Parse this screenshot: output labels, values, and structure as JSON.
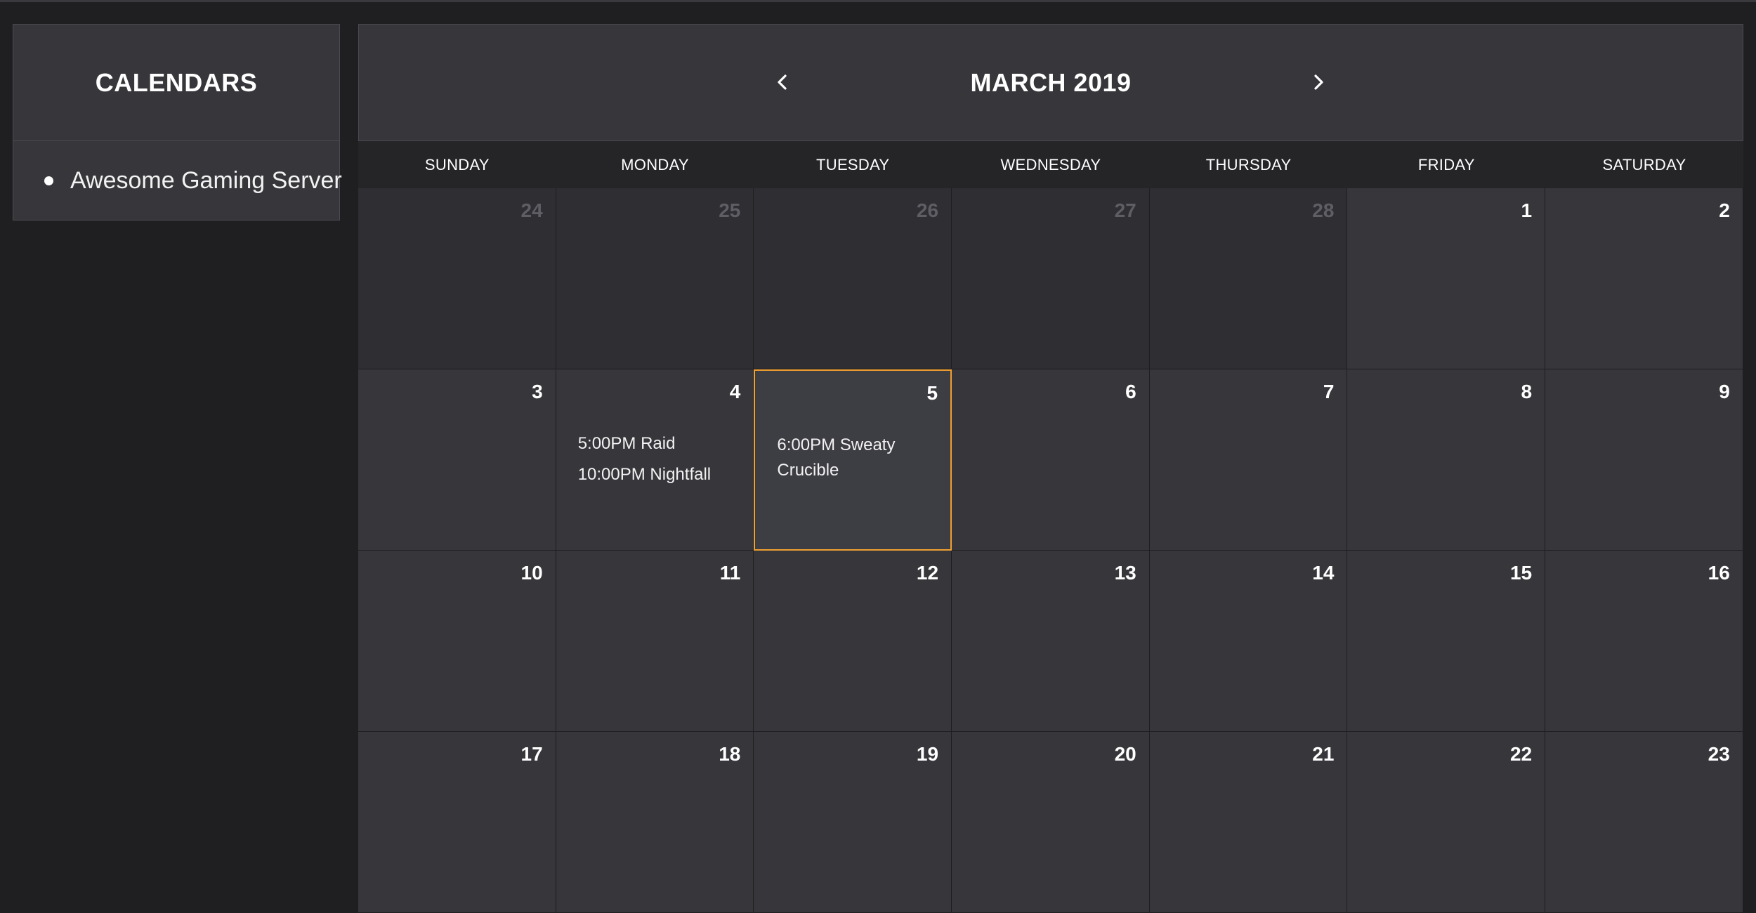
{
  "sidebar": {
    "title": "CALENDARS",
    "items": [
      {
        "label": "Awesome Gaming Server"
      }
    ]
  },
  "calendar": {
    "month_title": "MARCH 2019",
    "weekdays": [
      "SUNDAY",
      "MONDAY",
      "TUESDAY",
      "WEDNESDAY",
      "THURSDAY",
      "FRIDAY",
      "SATURDAY"
    ],
    "weeks": [
      [
        {
          "day": "24",
          "other": true,
          "events": []
        },
        {
          "day": "25",
          "other": true,
          "events": []
        },
        {
          "day": "26",
          "other": true,
          "events": []
        },
        {
          "day": "27",
          "other": true,
          "events": []
        },
        {
          "day": "28",
          "other": true,
          "events": []
        },
        {
          "day": "1",
          "other": false,
          "events": []
        },
        {
          "day": "2",
          "other": false,
          "events": []
        }
      ],
      [
        {
          "day": "3",
          "other": false,
          "events": []
        },
        {
          "day": "4",
          "other": false,
          "events": [
            "5:00PM Raid",
            "10:00PM Nightfall"
          ]
        },
        {
          "day": "5",
          "other": false,
          "selected": true,
          "events": [
            "6:00PM Sweaty Crucible"
          ]
        },
        {
          "day": "6",
          "other": false,
          "events": []
        },
        {
          "day": "7",
          "other": false,
          "events": []
        },
        {
          "day": "8",
          "other": false,
          "events": []
        },
        {
          "day": "9",
          "other": false,
          "events": []
        }
      ],
      [
        {
          "day": "10",
          "other": false,
          "events": []
        },
        {
          "day": "11",
          "other": false,
          "events": []
        },
        {
          "day": "12",
          "other": false,
          "events": []
        },
        {
          "day": "13",
          "other": false,
          "events": []
        },
        {
          "day": "14",
          "other": false,
          "events": []
        },
        {
          "day": "15",
          "other": false,
          "events": []
        },
        {
          "day": "16",
          "other": false,
          "events": []
        }
      ],
      [
        {
          "day": "17",
          "other": false,
          "events": []
        },
        {
          "day": "18",
          "other": false,
          "events": []
        },
        {
          "day": "19",
          "other": false,
          "events": []
        },
        {
          "day": "20",
          "other": false,
          "events": []
        },
        {
          "day": "21",
          "other": false,
          "events": []
        },
        {
          "day": "22",
          "other": false,
          "events": []
        },
        {
          "day": "23",
          "other": false,
          "events": []
        }
      ]
    ]
  },
  "icons": {
    "prev": "chevron-left-icon",
    "next": "chevron-right-icon",
    "bullet": "bullet-icon"
  },
  "colors": {
    "background": "#1f1f21",
    "panel": "#36363b",
    "selected_border": "#f0a030",
    "muted_day": "#5e5e64"
  }
}
